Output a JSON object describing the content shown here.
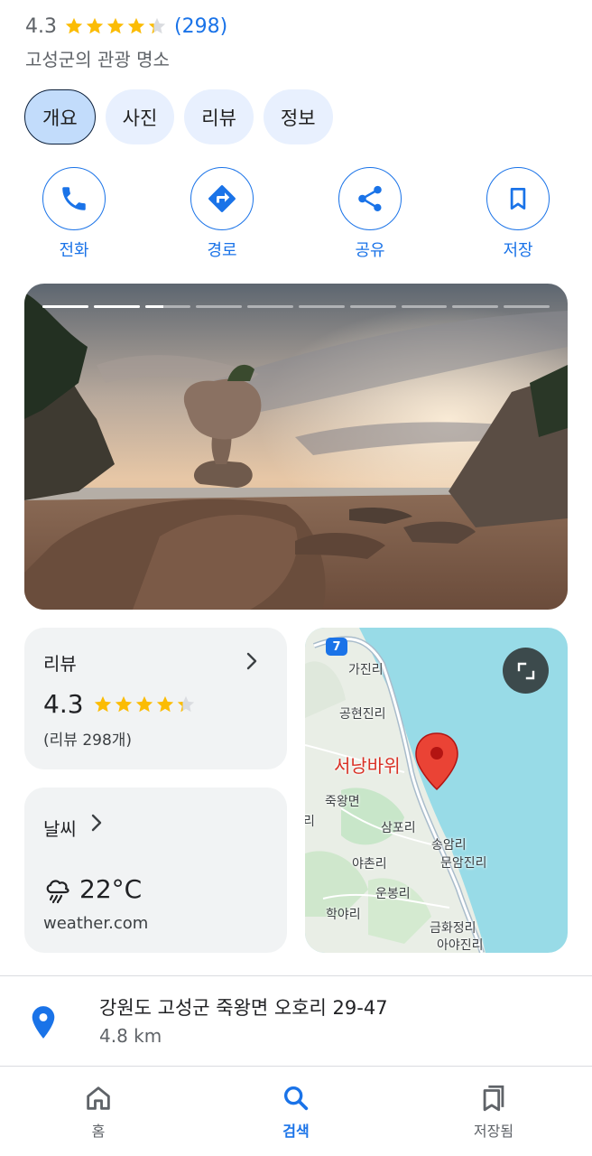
{
  "place": {
    "rating": "4.3",
    "rating_stars": 4.3,
    "review_count_text": "(298)",
    "category": "고성군의 관광 명소"
  },
  "tabs": [
    {
      "label": "개요",
      "active": true
    },
    {
      "label": "사진",
      "active": false
    },
    {
      "label": "리뷰",
      "active": false
    },
    {
      "label": "정보",
      "active": false
    }
  ],
  "actions": [
    {
      "label": "전화",
      "icon": "phone-icon"
    },
    {
      "label": "경로",
      "icon": "directions-icon"
    },
    {
      "label": "공유",
      "icon": "share-icon"
    },
    {
      "label": "저장",
      "icon": "bookmark-icon"
    }
  ],
  "photo": {
    "segments_total": 10,
    "segments_complete": 2,
    "current_segment_fraction": 0.4
  },
  "reviews_card": {
    "title": "리뷰",
    "rating": "4.3",
    "rating_stars": 4.3,
    "count_text": "(리뷰 298개)"
  },
  "weather_card": {
    "title": "날씨",
    "temperature": "22°C",
    "condition_icon": "rain-cloud-icon",
    "source": "weather.com"
  },
  "map": {
    "route_number": "7",
    "place_name": "서낭바위",
    "labels": [
      "가진리",
      "공현진리",
      "죽왕면",
      "삼포리",
      "송암리",
      "문암진리",
      "야촌리",
      "운봉리",
      "학야리",
      "금화정리",
      "아야진리",
      "리"
    ]
  },
  "address": {
    "text": "강원도 고성군 죽왕면 오호리 29-47",
    "distance": "4.8 km"
  },
  "bottom_nav": [
    {
      "label": "홈",
      "icon": "home-icon",
      "active": false
    },
    {
      "label": "검색",
      "icon": "search-icon",
      "active": true
    },
    {
      "label": "저장됨",
      "icon": "saved-icon",
      "active": false
    }
  ],
  "colors": {
    "accent": "#1a73e8",
    "star": "#fbbc04",
    "pin": "#ea4335",
    "card_bg": "#f1f3f4",
    "tab_bg": "#e8f0fe",
    "tab_active_bg": "#c2dcfb"
  }
}
